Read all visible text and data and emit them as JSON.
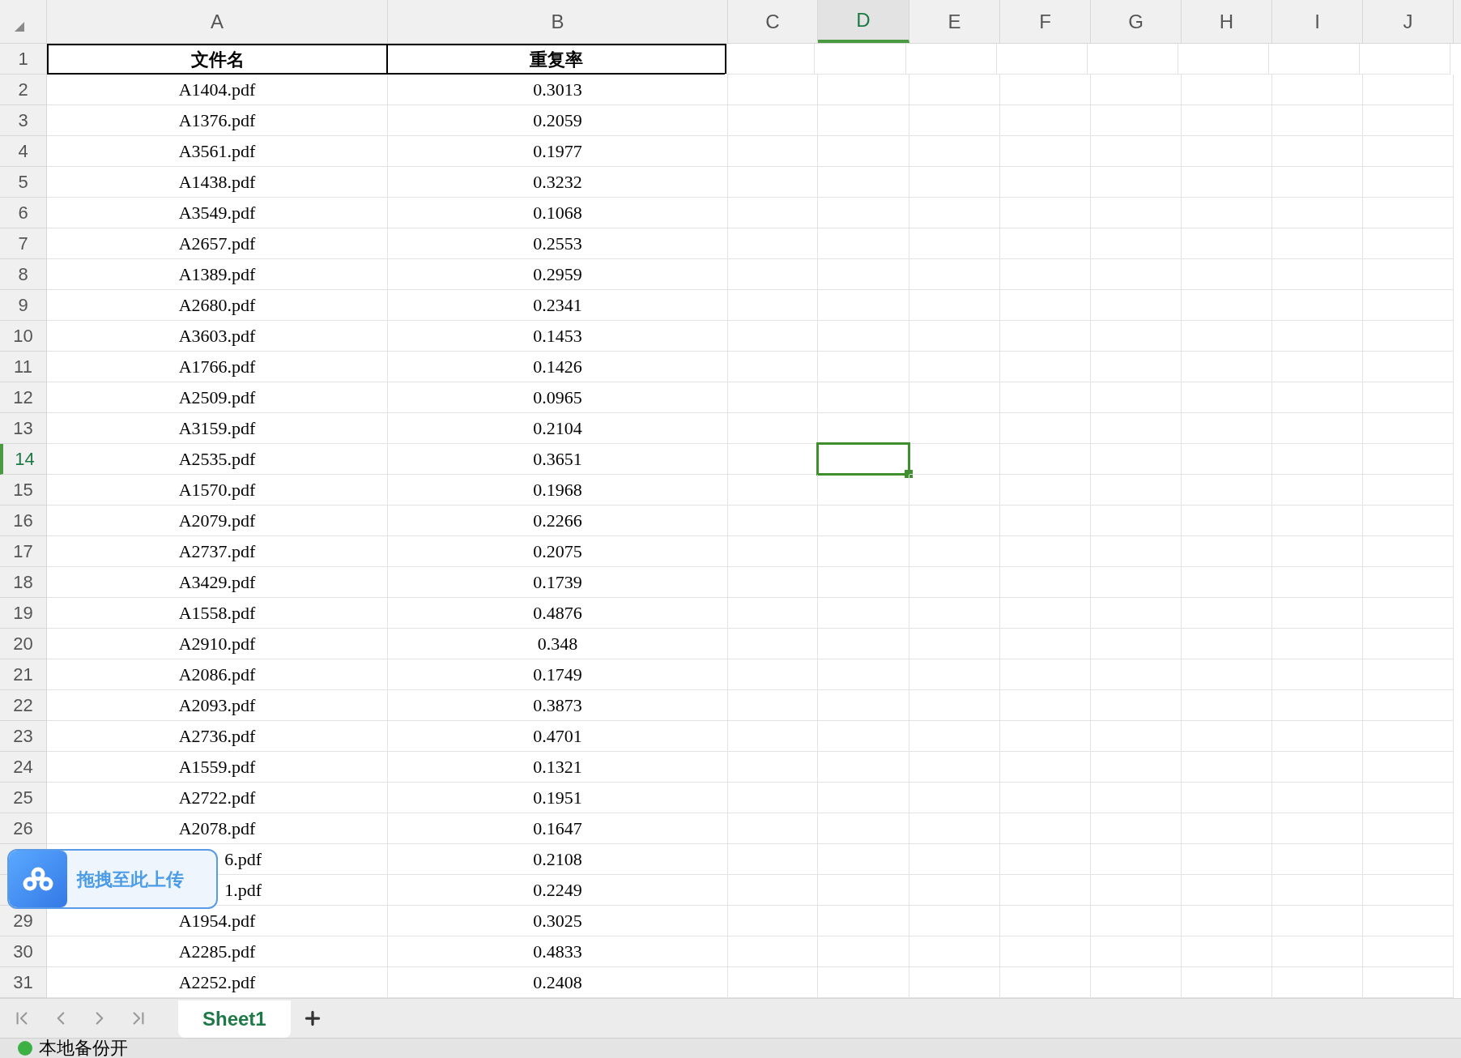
{
  "columns": [
    {
      "label": "A",
      "selected": false
    },
    {
      "label": "B",
      "selected": false
    },
    {
      "label": "C",
      "selected": false
    },
    {
      "label": "D",
      "selected": true
    },
    {
      "label": "E",
      "selected": false
    },
    {
      "label": "F",
      "selected": false
    },
    {
      "label": "G",
      "selected": false
    },
    {
      "label": "H",
      "selected": false
    },
    {
      "label": "I",
      "selected": false
    },
    {
      "label": "J",
      "selected": false
    }
  ],
  "header_row": {
    "number": "1",
    "cells": [
      "文件名",
      "重复率"
    ]
  },
  "rows": [
    {
      "number": "2",
      "cells": [
        "A1404.pdf",
        "0.3013"
      ],
      "selected": false
    },
    {
      "number": "3",
      "cells": [
        "A1376.pdf",
        "0.2059"
      ],
      "selected": false
    },
    {
      "number": "4",
      "cells": [
        "A3561.pdf",
        "0.1977"
      ],
      "selected": false
    },
    {
      "number": "5",
      "cells": [
        "A1438.pdf",
        "0.3232"
      ],
      "selected": false
    },
    {
      "number": "6",
      "cells": [
        "A3549.pdf",
        "0.1068"
      ],
      "selected": false
    },
    {
      "number": "7",
      "cells": [
        "A2657.pdf",
        "0.2553"
      ],
      "selected": false
    },
    {
      "number": "8",
      "cells": [
        "A1389.pdf",
        "0.2959"
      ],
      "selected": false
    },
    {
      "number": "9",
      "cells": [
        "A2680.pdf",
        "0.2341"
      ],
      "selected": false
    },
    {
      "number": "10",
      "cells": [
        "A3603.pdf",
        "0.1453"
      ],
      "selected": false
    },
    {
      "number": "11",
      "cells": [
        "A1766.pdf",
        "0.1426"
      ],
      "selected": false
    },
    {
      "number": "12",
      "cells": [
        "A2509.pdf",
        "0.0965"
      ],
      "selected": false
    },
    {
      "number": "13",
      "cells": [
        "A3159.pdf",
        "0.2104"
      ],
      "selected": false
    },
    {
      "number": "14",
      "cells": [
        "A2535.pdf",
        "0.3651"
      ],
      "selected": true
    },
    {
      "number": "15",
      "cells": [
        "A1570.pdf",
        "0.1968"
      ],
      "selected": false
    },
    {
      "number": "16",
      "cells": [
        "A2079.pdf",
        "0.2266"
      ],
      "selected": false
    },
    {
      "number": "17",
      "cells": [
        "A2737.pdf",
        "0.2075"
      ],
      "selected": false
    },
    {
      "number": "18",
      "cells": [
        "A3429.pdf",
        "0.1739"
      ],
      "selected": false
    },
    {
      "number": "19",
      "cells": [
        "A1558.pdf",
        "0.4876"
      ],
      "selected": false
    },
    {
      "number": "20",
      "cells": [
        "A2910.pdf",
        "0.348"
      ],
      "selected": false
    },
    {
      "number": "21",
      "cells": [
        "A2086.pdf",
        "0.1749"
      ],
      "selected": false
    },
    {
      "number": "22",
      "cells": [
        "A2093.pdf",
        "0.3873"
      ],
      "selected": false
    },
    {
      "number": "23",
      "cells": [
        "A2736.pdf",
        "0.4701"
      ],
      "selected": false
    },
    {
      "number": "24",
      "cells": [
        "A1559.pdf",
        "0.1321"
      ],
      "selected": false
    },
    {
      "number": "25",
      "cells": [
        "A2722.pdf",
        "0.1951"
      ],
      "selected": false
    },
    {
      "number": "26",
      "cells": [
        "A2078.pdf",
        "0.1647"
      ],
      "selected": false
    },
    {
      "cells": [
        "6.pdf",
        "0.2108"
      ],
      "selected": false
    },
    {
      "cells": [
        "1.pdf",
        "0.2249"
      ],
      "selected": false
    },
    {
      "number": "29",
      "cells": [
        "A1954.pdf",
        "0.3025"
      ],
      "selected": false
    },
    {
      "number": "30",
      "cells": [
        "A2285.pdf",
        "0.4833"
      ],
      "selected": false
    },
    {
      "number": "31",
      "cells": [
        "A2252.pdf",
        "0.2408"
      ],
      "selected": false
    }
  ],
  "upload_widget": {
    "label": "拖拽至此上传"
  },
  "sheet_tabs": [
    {
      "label": "Sheet1",
      "selected": true
    }
  ],
  "status_bar": {
    "text": "本地备份开"
  }
}
